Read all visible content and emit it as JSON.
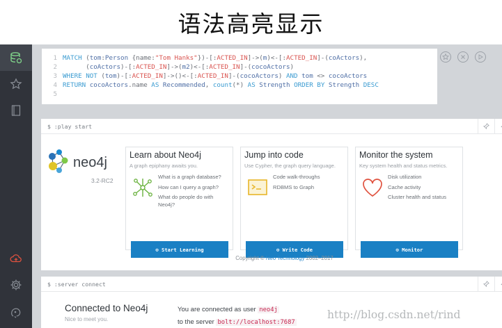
{
  "caption": {
    "title": "语法高亮显示"
  },
  "sidebar": {
    "items": [
      {
        "icon": "database-icon",
        "active": true
      },
      {
        "icon": "star-icon",
        "active": false
      },
      {
        "icon": "book-icon",
        "active": false
      },
      {
        "icon": "cloud-sync-icon",
        "active": false
      },
      {
        "icon": "gear-icon",
        "active": false
      },
      {
        "icon": "about-icon",
        "active": false
      }
    ],
    "accent": "#e0523f"
  },
  "editor": {
    "line_numbers": [
      "1",
      "2",
      "3",
      "4",
      "5"
    ],
    "actions": [
      "star-icon",
      "close-icon",
      "play-icon"
    ]
  },
  "play_frame": {
    "command": "$ :play start",
    "logo": {
      "text": "neo4j",
      "version": "3.2-RC2"
    },
    "cards": [
      {
        "title": "Learn about Neo4j",
        "subtitle": "A graph epiphany awaits you.",
        "icon": "graph-network-icon",
        "items": [
          "What is a graph database?",
          "How can I query a graph?",
          "What do people do with Neo4j?"
        ],
        "button": "⊙ Start Learning"
      },
      {
        "title": "Jump into code",
        "subtitle": "Use Cypher, the graph query language.",
        "icon": "code-terminal-icon",
        "items": [
          "Code walk-throughs",
          "RDBMS to Graph"
        ],
        "button": "⊙ Write Code"
      },
      {
        "title": "Monitor the system",
        "subtitle": "Key system health and status metrics.",
        "icon": "heart-icon",
        "items": [
          "Disk utilization",
          "Cache activity",
          "Cluster health and status"
        ],
        "button": "⊙ Monitor"
      }
    ],
    "copyright": {
      "prefix": "Copyright © ",
      "link": "Neo Technology",
      "suffix": " 2002–2017"
    }
  },
  "server_frame": {
    "command": "$ :server connect",
    "title": "Connected to Neo4j",
    "subtitle": "Nice to meet you.",
    "user_prefix": "You are connected as user ",
    "user": "neo4j",
    "server_prefix": "to the server ",
    "server": "bolt://localhost:7687"
  },
  "watermark": "http://blog.csdn.net/rind",
  "colors": {
    "primary_button": "#1a80c4",
    "sidebar_bg": "#30333a",
    "stage_bg": "#d2d5d9"
  }
}
